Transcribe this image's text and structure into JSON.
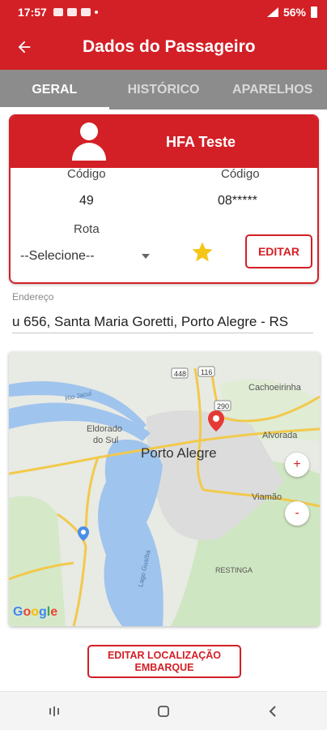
{
  "status_bar": {
    "time": "17:57",
    "battery": "56%"
  },
  "app_bar": {
    "title": "Dados do Passageiro"
  },
  "tabs": [
    {
      "label": "GERAL",
      "active": true
    },
    {
      "label": "HISTÓRICO",
      "active": false
    },
    {
      "label": "APARELHOS",
      "active": false
    }
  ],
  "card": {
    "name": "HFA Teste",
    "codigo_label_1": "Código",
    "codigo_value_1": "49",
    "codigo_label_2": "Código",
    "codigo_value_2": "08*****",
    "rota_label": "Rota",
    "rota_value": "--Selecione--",
    "edit_button": "EDITAR",
    "favorite_icon": "star-icon"
  },
  "endereco": {
    "label": "Endereço",
    "value": "u 656, Santa Maria Goretti, Porto Alegre - RS"
  },
  "map": {
    "places": [
      "Cachoeirinha",
      "Alvorada",
      "Eldorado do Sul",
      "Porto Alegre",
      "Viamão",
      "RESTINGA",
      "Lago Guaíba",
      "Rio Jacuí"
    ],
    "road_labels": [
      "448",
      "116",
      "290"
    ],
    "zoom_in": "+",
    "zoom_out": "-",
    "logo": "Google"
  },
  "location_button": {
    "line1": "EDITAR LOCALIZAÇÃO",
    "line2": "EMBARQUE"
  },
  "colors": {
    "brand": "#d31f26",
    "tabs_bg": "#8c8c8c",
    "star": "#f5c518",
    "water": "#9fc4ed"
  }
}
